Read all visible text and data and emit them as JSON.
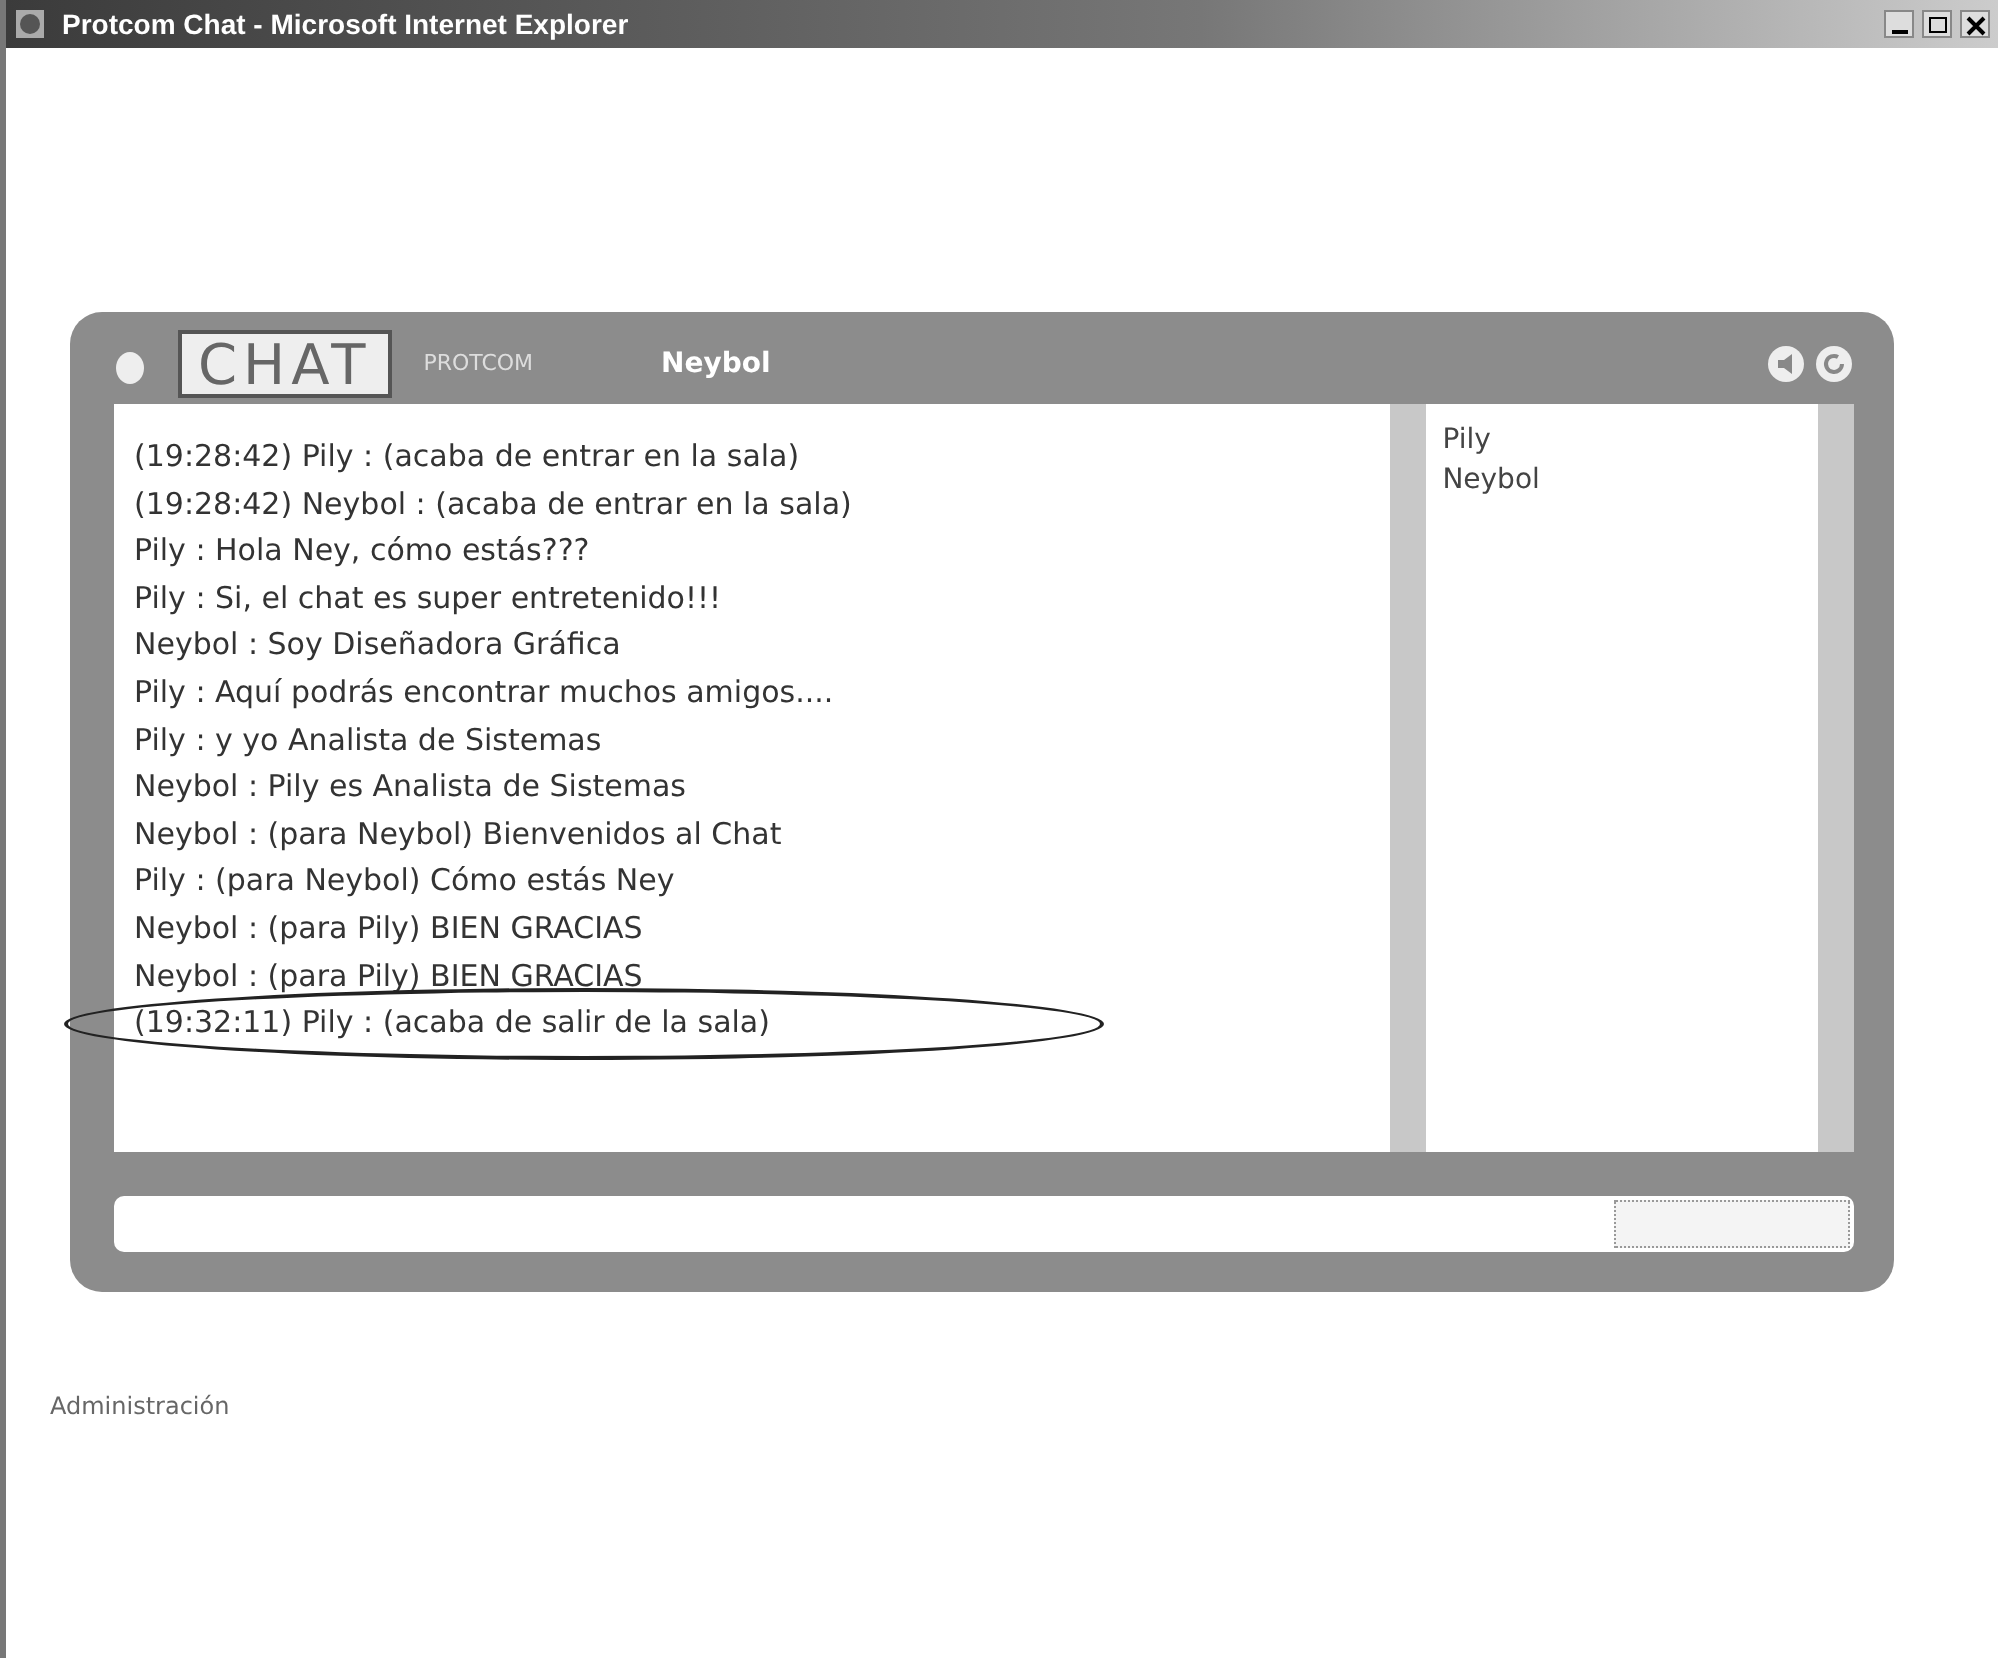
{
  "window": {
    "title": "Protcom Chat - Microsoft Internet Explorer"
  },
  "chat": {
    "logo": "CHAT",
    "brand": "PROTCOM",
    "user": "Neybol",
    "messages": [
      {
        "text": "(19:28:42) Pily : (acaba de entrar en la sala)",
        "circled": false
      },
      {
        "text": "(19:28:42) Neybol : (acaba de entrar en la sala)",
        "circled": false
      },
      {
        "text": "Pily : Hola Ney, cómo estás???",
        "circled": false
      },
      {
        "text": "Pily : Si, el chat  es super entretenido!!!",
        "circled": false
      },
      {
        "text": "Neybol : Soy Diseñadora Gráfica",
        "circled": false
      },
      {
        "text": "Pily : Aquí podrás encontrar muchos amigos....",
        "circled": false
      },
      {
        "text": "Pily : y yo Analista de Sistemas",
        "circled": false
      },
      {
        "text": "Neybol : Pily es Analista de Sistemas",
        "circled": false
      },
      {
        "text": "Neybol : (para Neybol) Bienvenidos al Chat",
        "circled": false
      },
      {
        "text": "Pily : (para Neybol) Cómo estás Ney",
        "circled": false
      },
      {
        "text": "Neybol : (para Pily) BIEN GRACIAS",
        "circled": false
      },
      {
        "text": "Neybol : (para Pily) BIEN GRACIAS",
        "circled": false
      },
      {
        "text": "(19:32:11) Pily : (acaba de salir de la sala)",
        "circled": true
      }
    ],
    "users": [
      "Pily",
      "Neybol"
    ]
  },
  "footer_link": "Administración"
}
